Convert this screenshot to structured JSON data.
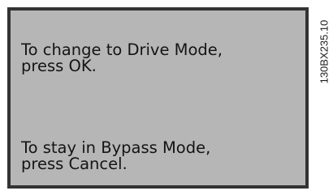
{
  "display": {
    "message_drive": {
      "line1": "To change to Drive Mode,",
      "line2": "press OK."
    },
    "message_bypass": {
      "line1": "To stay in Bypass Mode,",
      "line2": "press Cancel."
    }
  },
  "figure_id": "130BX235.10",
  "colors": {
    "screen_background": "#b6b6b6",
    "screen_border": "#333333",
    "text": "#141414"
  }
}
